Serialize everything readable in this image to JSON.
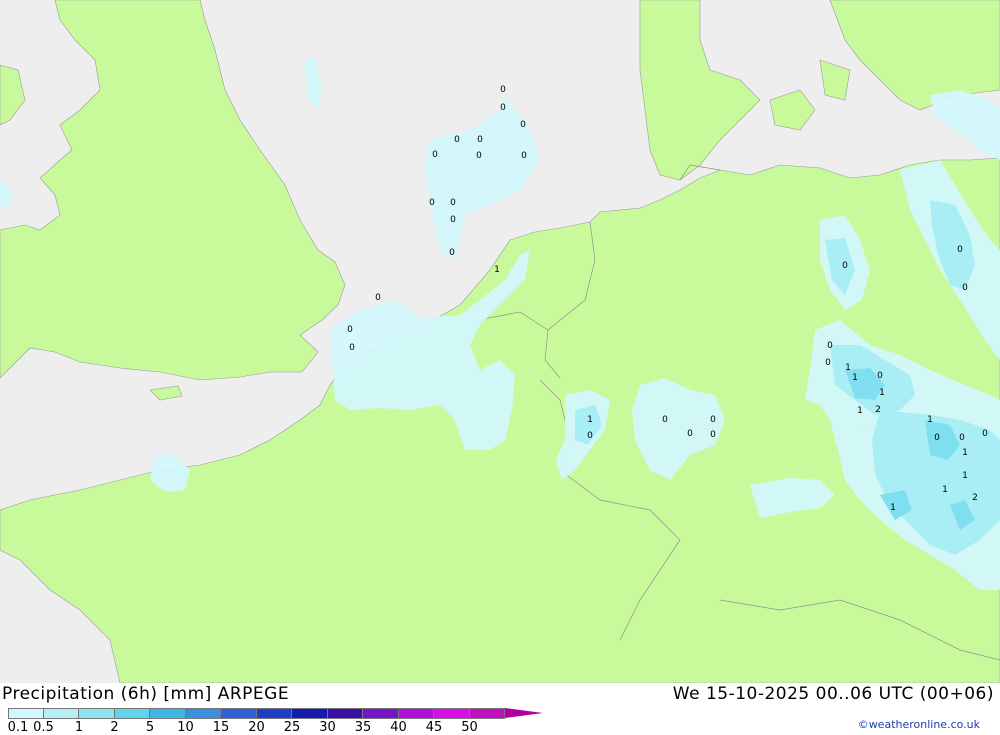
{
  "map": {
    "colors": {
      "land": "#c8fa9c",
      "sea": "#eeeeee",
      "precip_light": "#d2f8fb",
      "precip_medium": "#aaeef5",
      "precip_heavy": "#7fdff0",
      "border": "#a0a0a0"
    },
    "precip_values": [
      "0",
      "0",
      "0",
      "0",
      "0",
      "0",
      "0",
      "0",
      "0",
      "0",
      "0",
      "1",
      "0",
      "0",
      "0",
      "0",
      "0",
      "0",
      "1",
      "0",
      "1",
      "1",
      "1",
      "2",
      "1",
      "0",
      "0",
      "0",
      "1",
      "1",
      "1",
      "1",
      "2",
      "1",
      "0",
      "0",
      "0",
      "0",
      "0",
      "0",
      "0",
      "0"
    ]
  },
  "footer": {
    "title_left": "Precipitation (6h) [mm] ARPEGE",
    "title_right": "We 15-10-2025 00..06 UTC (00+06)",
    "credit": "©weatheronline.co.uk",
    "legend": {
      "labels": [
        "0.1",
        "0.5",
        "1",
        "2",
        "5",
        "10",
        "15",
        "20",
        "25",
        "30",
        "35",
        "40",
        "45",
        "50"
      ],
      "colors": [
        "#d2f8fb",
        "#b4f0f6",
        "#8de4f2",
        "#62d3ec",
        "#3fb5e3",
        "#3a8fdf",
        "#2d63d9",
        "#1f3ec8",
        "#141ab0",
        "#3c0fa8",
        "#7a12c7",
        "#b00ed8",
        "#d90ee6",
        "#c40cc0"
      ],
      "arrow_color": "#b0009f"
    }
  }
}
